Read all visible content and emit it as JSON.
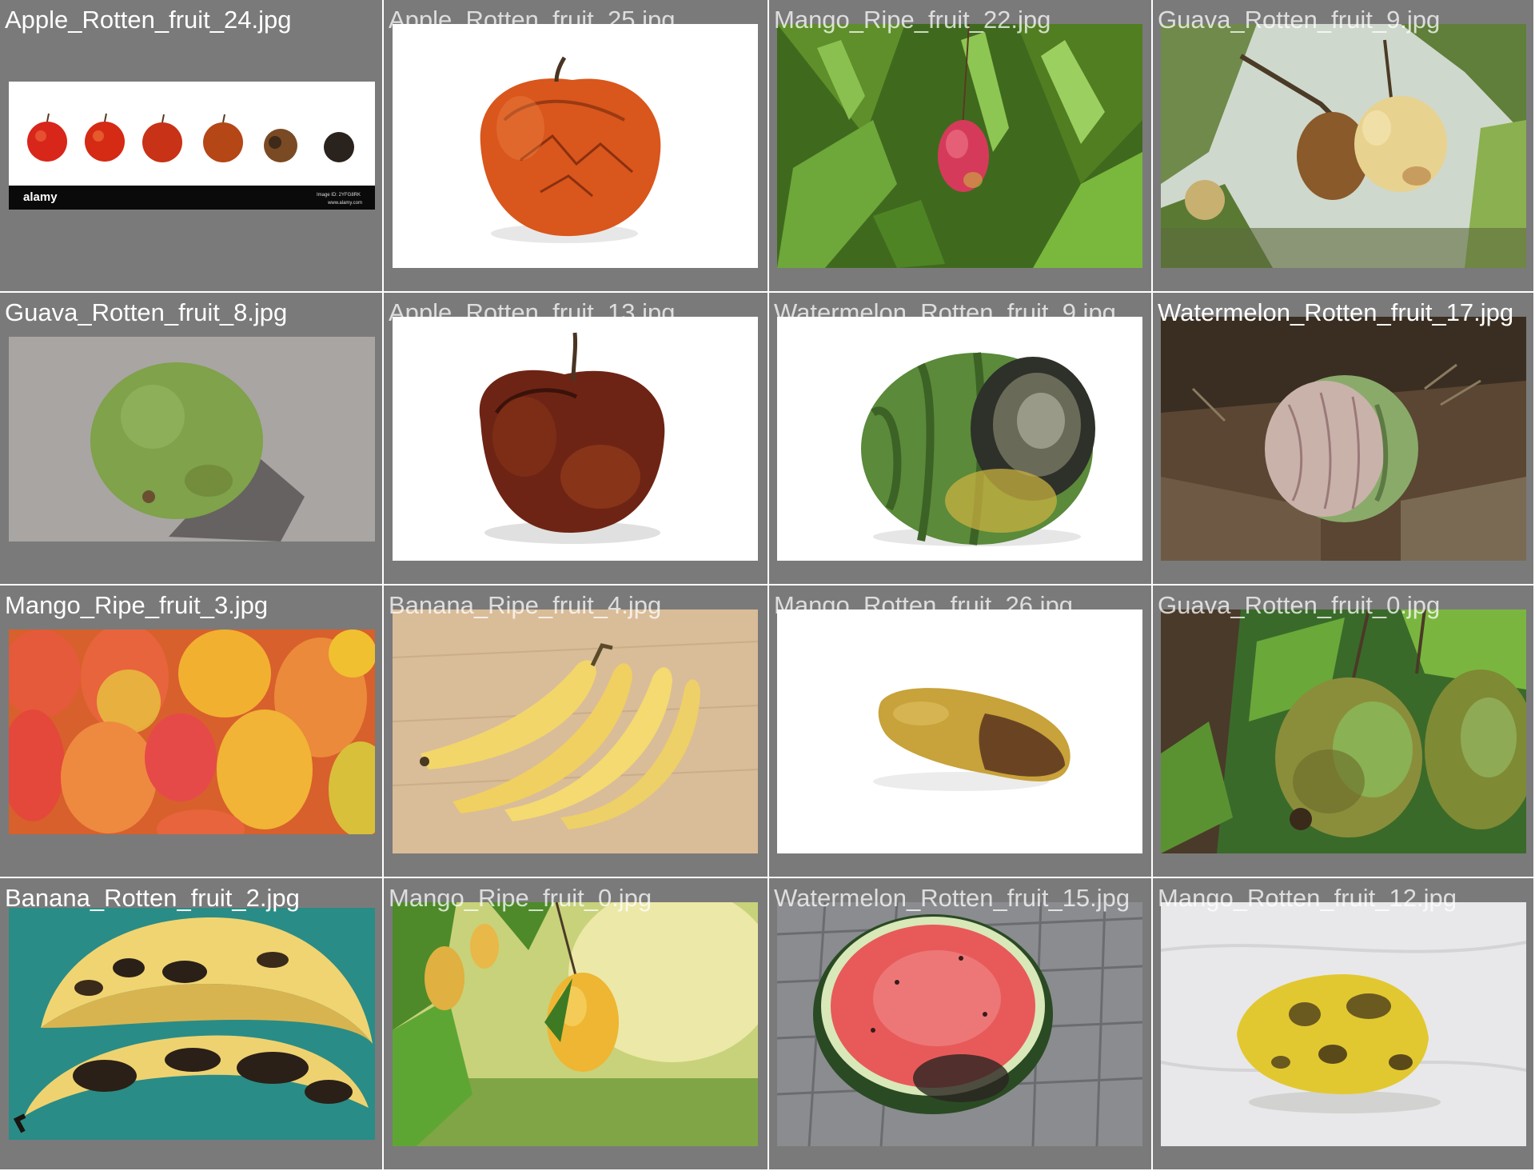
{
  "gallery": {
    "items": [
      {
        "filename": "Apple_Rotten_fruit_24.jpg",
        "kind": "apples-row",
        "watermark_left": "alamy",
        "watermark_right_1": "Image ID: 2YFG8RK",
        "watermark_right_2": "www.alamy.com"
      },
      {
        "filename": "Apple_Rotten_fruit_25.jpg",
        "kind": "apple-wrinkled"
      },
      {
        "filename": "Mango_Ripe_fruit_22.jpg",
        "kind": "mango-tree"
      },
      {
        "filename": "Guava_Rotten_fruit_9.jpg",
        "kind": "guava-branch"
      },
      {
        "filename": "Guava_Rotten_fruit_8.jpg",
        "kind": "guava-stone"
      },
      {
        "filename": "Apple_Rotten_fruit_13.jpg",
        "kind": "apple-dark"
      },
      {
        "filename": "Watermelon_Rotten_fruit_9.jpg",
        "kind": "watermelon-rotten"
      },
      {
        "filename": "Watermelon_Rotten_fruit_17.jpg",
        "kind": "watermelon-soil"
      },
      {
        "filename": "Mango_Ripe_fruit_3.jpg",
        "kind": "mango-pile"
      },
      {
        "filename": "Banana_Ripe_fruit_4.jpg",
        "kind": "bananas-wood"
      },
      {
        "filename": "Mango_Rotten_fruit_26.jpg",
        "kind": "mango-rotten-white"
      },
      {
        "filename": "Guava_Rotten_fruit_0.jpg",
        "kind": "guava-tree"
      },
      {
        "filename": "Banana_Rotten_fruit_2.jpg",
        "kind": "bananas-rotten"
      },
      {
        "filename": "Mango_Ripe_fruit_0.jpg",
        "kind": "mango-hanging"
      },
      {
        "filename": "Watermelon_Rotten_fruit_15.jpg",
        "kind": "watermelon-half"
      },
      {
        "filename": "Mango_Rotten_fruit_12.jpg",
        "kind": "mango-rotten-cloth"
      }
    ]
  },
  "colors": {
    "cell_bg": "#7a7a7a",
    "label_text": "#ffffff"
  }
}
